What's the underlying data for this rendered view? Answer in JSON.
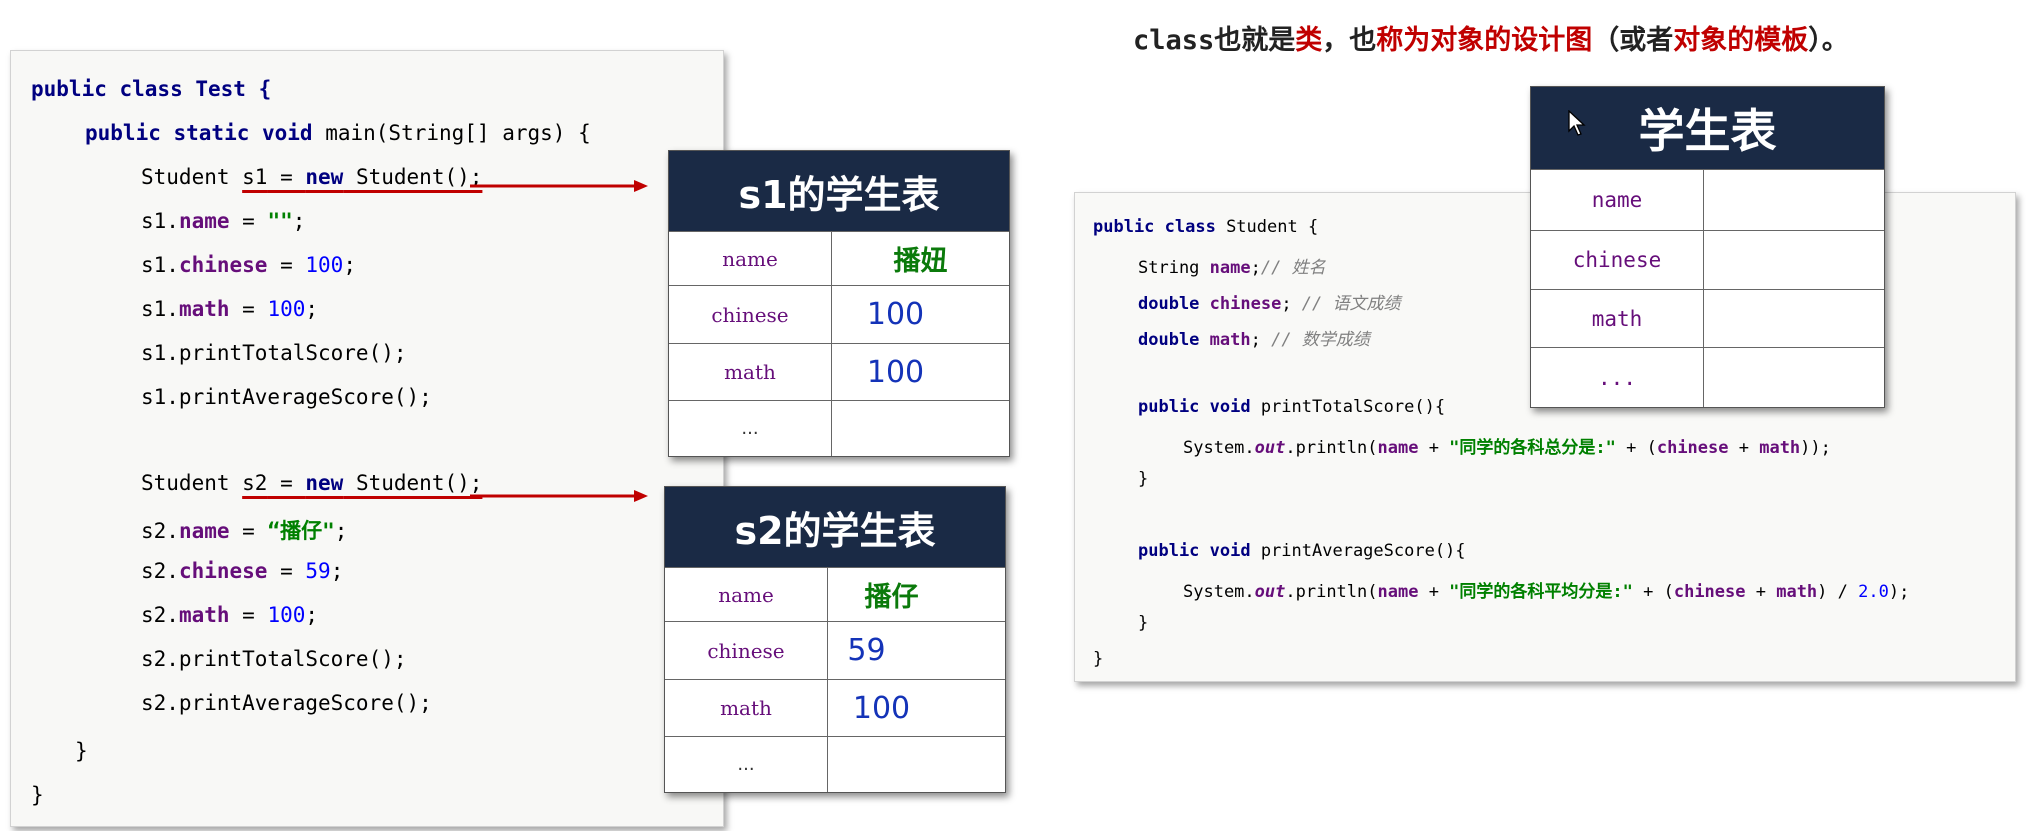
{
  "title": {
    "p1": "class",
    "p2": "也就是",
    "p3": "类",
    "p4": "，也",
    "p5": "称为对象的设计图",
    "p6": "（或者",
    "p7": "对象的模板",
    "p8": "）。"
  },
  "main_code": {
    "l1": "public class Test {",
    "l2a": "public static void ",
    "l2b": "main(String[] args) {",
    "s1": {
      "decl_a": "Student ",
      "decl_var": "s1",
      "decl_b": " = ",
      "decl_new": "new",
      "decl_c": " Student();",
      "name_a": "s1.",
      "name_f": "name",
      "name_b": " = ",
      "name_v": "\"\"",
      "name_end": ";",
      "chinese_a": "s1.",
      "chinese_f": "chinese",
      "chinese_b": " = ",
      "chinese_v": "100",
      "chinese_end": ";",
      "math_a": "s1.",
      "math_f": "math",
      "math_b": " = ",
      "math_v": "100",
      "math_end": ";",
      "total": "s1.printTotalScore();",
      "avg": "s1.printAverageScore();"
    },
    "s2": {
      "decl_a": "Student ",
      "decl_var": "s2",
      "decl_b": " = ",
      "decl_new": "new",
      "decl_c": " Student();",
      "name_a": "s2.",
      "name_f": "name",
      "name_b": " = ",
      "name_v": "“播仔\"",
      "name_end": ";",
      "chinese_a": "s2.",
      "chinese_f": "chinese",
      "chinese_b": " = ",
      "chinese_v": "59",
      "chinese_end": ";",
      "math_a": "s2.",
      "math_f": "math",
      "math_b": " = ",
      "math_v": "100",
      "math_end": ";",
      "total": "s2.printTotalScore();",
      "avg": "s2.printAverageScore();"
    },
    "close_inner": "}",
    "close_outer": "}"
  },
  "s1_table": {
    "header": "s1的学生表",
    "rows": [
      {
        "label": "name",
        "value": "播妞"
      },
      {
        "label": "chinese",
        "value": "100"
      },
      {
        "label": "math",
        "value": "100"
      },
      {
        "label": "...",
        "value": ""
      }
    ]
  },
  "s2_table": {
    "header": "s2的学生表",
    "rows": [
      {
        "label": "name",
        "value": "播仔"
      },
      {
        "label": "chinese",
        "value": "59"
      },
      {
        "label": "math",
        "value": "100"
      },
      {
        "label": "...",
        "value": ""
      }
    ]
  },
  "student_code": {
    "l1a": "public class ",
    "l1b": "Student {",
    "f1a": "String ",
    "f1b": "name",
    "f1c": ";",
    "f1d": "// 姓名",
    "f2a": "double ",
    "f2b": "chinese",
    "f2c": "; ",
    "f2d": "// 语文成绩",
    "f3a": "double ",
    "f3b": "math",
    "f3c": "; ",
    "f3d": "// 数学成绩",
    "m1a": "public void ",
    "m1b": "printTotalScore(){",
    "p1a": "System.",
    "p1b": "out",
    "p1c": ".println(",
    "p1d": "name",
    "p1e": " + ",
    "p1f": "\"同学的各科总分是:\"",
    "p1g": " + (",
    "p1h": "chinese",
    "p1i": " + ",
    "p1j": "math",
    "p1k": "));",
    "c1": "}",
    "m2a": "public void ",
    "m2b": "printAverageScore(){",
    "p2a": "System.",
    "p2b": "out",
    "p2c": ".println(",
    "p2d": "name",
    "p2e": " + ",
    "p2f": "\"同学的各科平均分是:\"",
    "p2g": " + (",
    "p2h": "chinese",
    "p2i": " + ",
    "p2j": "math",
    "p2k": ") / ",
    "p2l": "2.0",
    "p2m": ");",
    "c2": "}",
    "c3": "}"
  },
  "template_table": {
    "header": "学生表",
    "rows": [
      {
        "label": "name"
      },
      {
        "label": "chinese"
      },
      {
        "label": "math"
      },
      {
        "label": "..."
      }
    ]
  },
  "colors": {
    "header_bg": "#1a2a45",
    "arrow": "#c00000",
    "keyword": "#000080",
    "field": "#660e7a",
    "string": "#008000",
    "number": "#0000ff"
  },
  "icons": [
    "cursor-icon",
    "arrow-right-icon"
  ]
}
